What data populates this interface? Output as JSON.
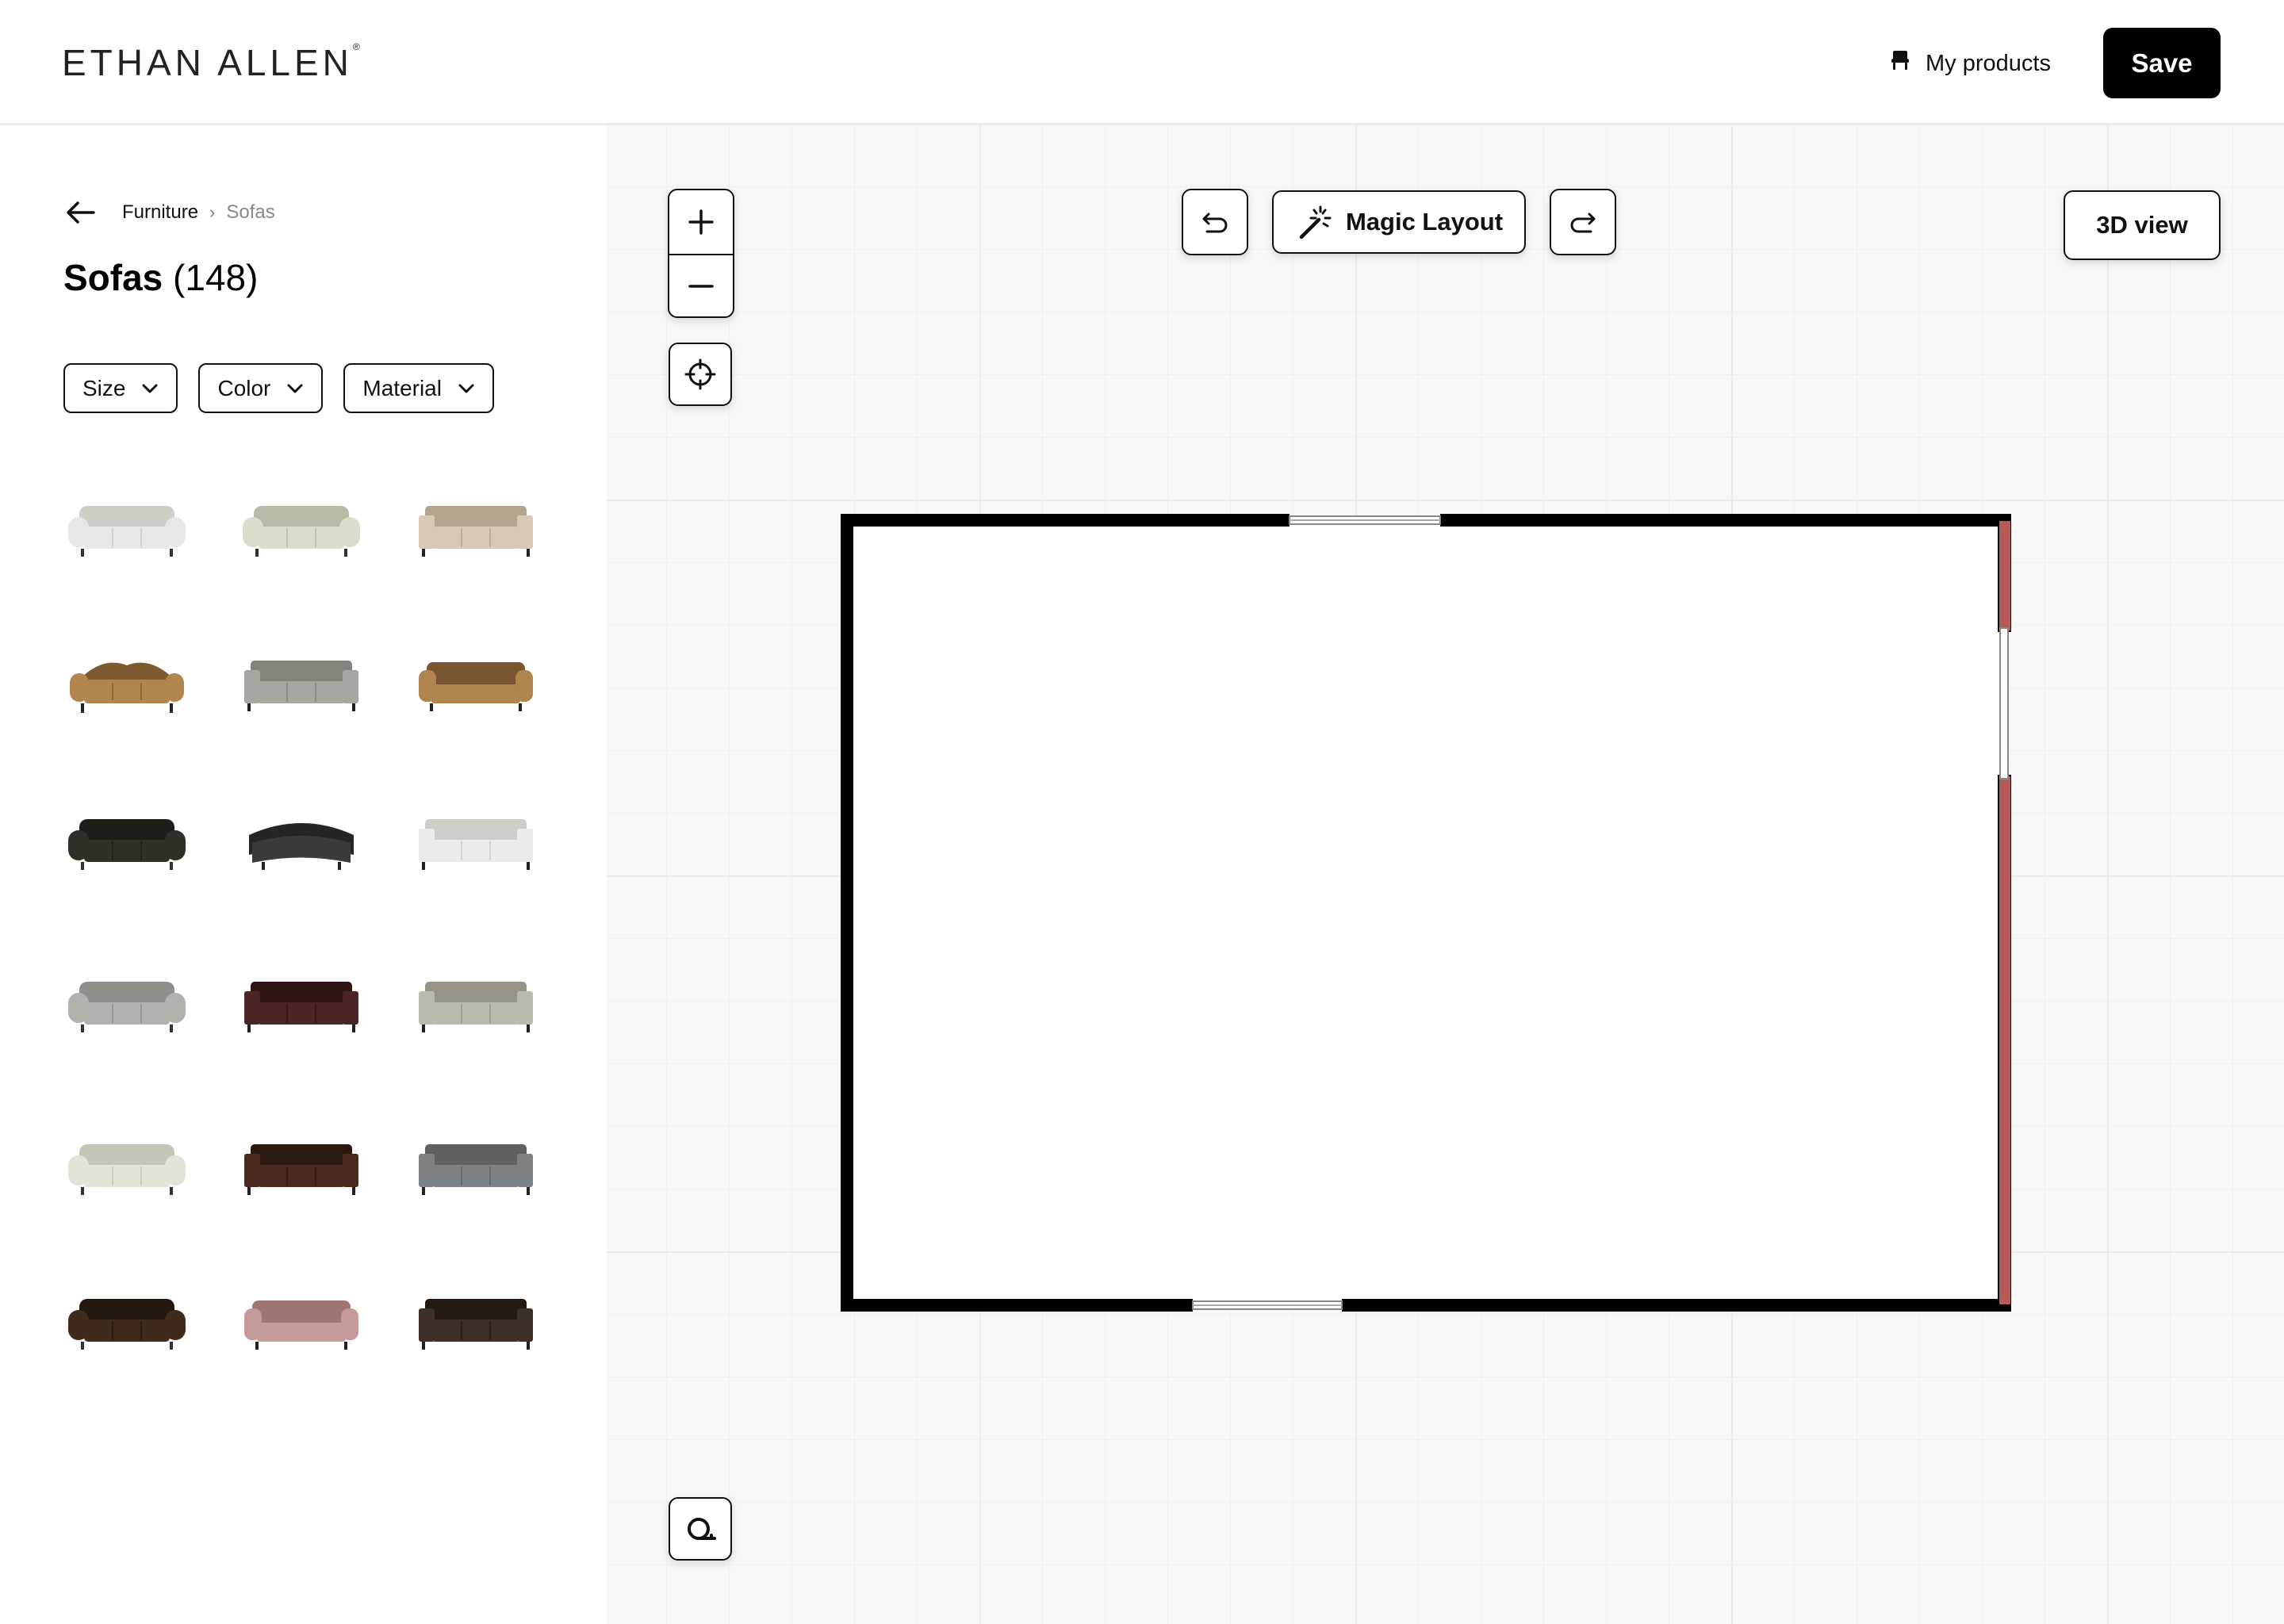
{
  "header": {
    "brand": "ETHAN ALLEN",
    "my_products_label": "My products",
    "save_label": "Save"
  },
  "sidebar": {
    "breadcrumb": {
      "parent": "Furniture",
      "separator": "›",
      "current": "Sofas"
    },
    "category": {
      "name": "Sofas",
      "count": "(148)"
    },
    "filters": [
      {
        "label": "Size"
      },
      {
        "label": "Color"
      },
      {
        "label": "Material"
      }
    ],
    "products": [
      {
        "color": "#e9e7e3",
        "shade": "#cfccc6",
        "style": "roll-arm"
      },
      {
        "color": "#dcdccc",
        "shade": "#b9baa6",
        "style": "roll-arm"
      },
      {
        "color": "#d8c8b5",
        "shade": "#b6a48f",
        "style": "track-arm"
      },
      {
        "color": "#b08550",
        "shade": "#7e5a30",
        "style": "camel-back"
      },
      {
        "color": "#a9a5a0",
        "shade": "#86827c",
        "style": "track-arm"
      },
      {
        "color": "#b0844e",
        "shade": "#7a5630",
        "style": "chesterfield"
      },
      {
        "color": "#2f3128",
        "shade": "#1c1e17",
        "style": "roll-arm"
      },
      {
        "color": "#3a3b3d",
        "shade": "#242527",
        "style": "curved"
      },
      {
        "color": "#ecebe7",
        "shade": "#cfcdc8",
        "style": "track-arm"
      },
      {
        "color": "#aeb3ab",
        "shade": "#8b9089",
        "style": "roll-arm"
      },
      {
        "color": "#4b2526",
        "shade": "#2e1516",
        "style": "track-arm"
      },
      {
        "color": "#bdb9af",
        "shade": "#98948a",
        "style": "track-arm"
      },
      {
        "color": "#e5e2d8",
        "shade": "#c8c4b8",
        "style": "roll-arm"
      },
      {
        "color": "#4a2a1e",
        "shade": "#2c1910",
        "style": "track-arm"
      },
      {
        "color": "#7b8184",
        "shade": "#5c6265",
        "style": "track-arm"
      },
      {
        "color": "#3f2a1c",
        "shade": "#251810",
        "style": "roll-arm"
      },
      {
        "color": "#c69a98",
        "shade": "#a07573",
        "style": "chesterfield"
      },
      {
        "color": "#3e3027",
        "shade": "#241a14",
        "style": "track-arm"
      }
    ]
  },
  "canvas": {
    "magic_layout_label": "Magic Layout",
    "view_3d_label": "3D view",
    "icons": {
      "zoom_in": "plus-icon",
      "zoom_out": "minus-icon",
      "recenter": "crosshair-icon",
      "undo": "undo-icon",
      "redo": "redo-icon",
      "magic": "magic-wand-icon",
      "measure": "tape-measure-icon"
    },
    "room": {
      "wall_color": "#000000",
      "highlight_wall_color": "#b55a57"
    }
  }
}
